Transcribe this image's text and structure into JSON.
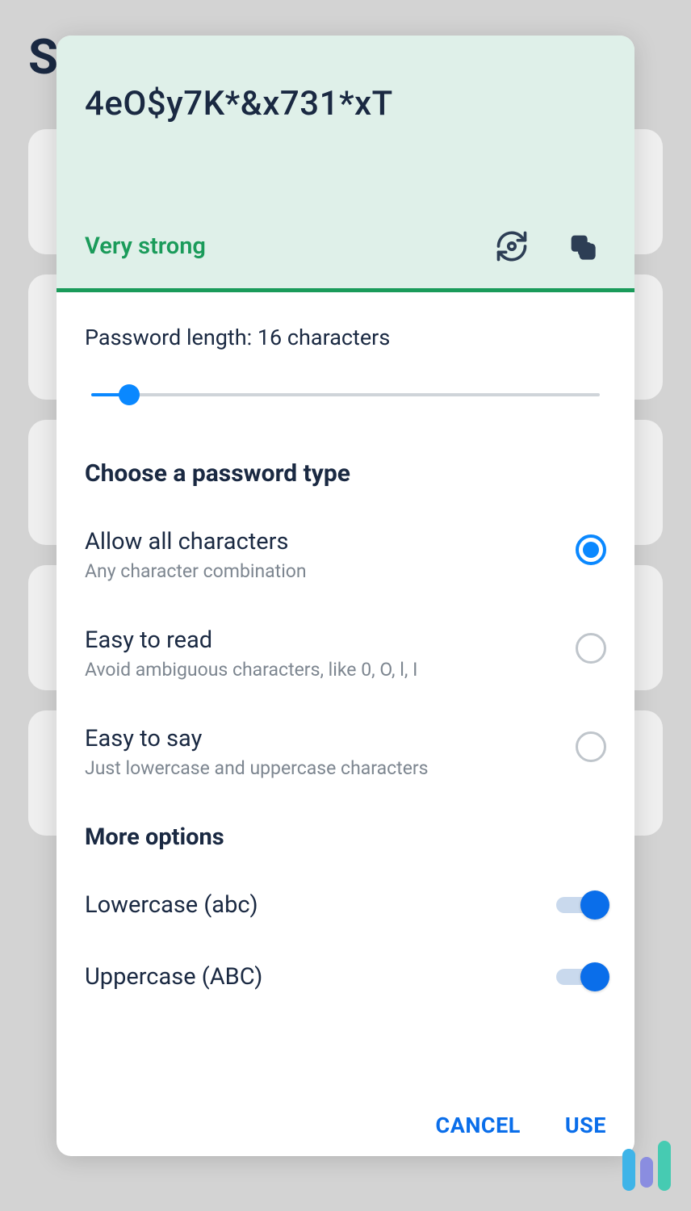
{
  "bg": {
    "letter": "S"
  },
  "header": {
    "password": "4eO$y7K*&x731*xT",
    "strength": "Very strong"
  },
  "length": {
    "label": "Password length: 16 characters"
  },
  "typeSection": {
    "title": "Choose a password type",
    "options": [
      {
        "title": "Allow all characters",
        "subtitle": "Any character combination",
        "selected": true
      },
      {
        "title": "Easy to read",
        "subtitle": "Avoid ambiguous characters, like 0, O, l, I",
        "selected": false
      },
      {
        "title": "Easy to say",
        "subtitle": "Just lowercase and uppercase characters",
        "selected": false
      }
    ]
  },
  "moreSection": {
    "title": "More options",
    "options": [
      {
        "label": "Lowercase (abc)",
        "on": true
      },
      {
        "label": "Uppercase (ABC)",
        "on": true
      }
    ]
  },
  "actions": {
    "cancel": "CANCEL",
    "use": "USE"
  }
}
